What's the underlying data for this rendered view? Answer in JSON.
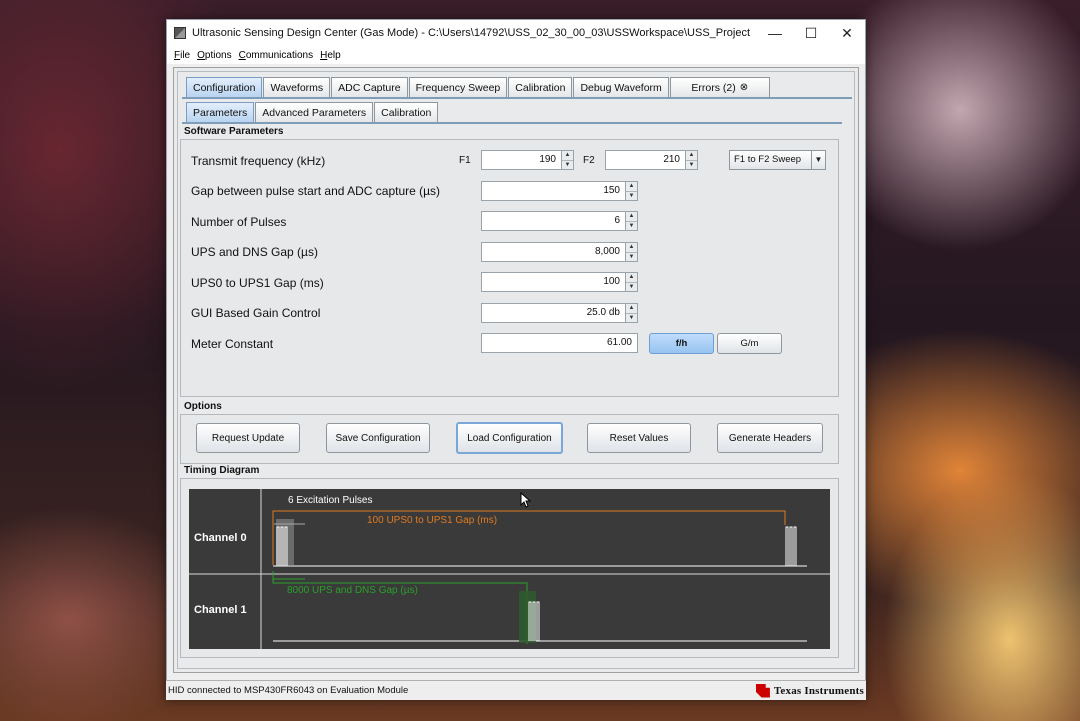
{
  "window": {
    "title": "Ultrasonic Sensing Design Center (Gas Mode) - C:\\Users\\14792\\USS_02_30_00_03\\USSWorkspace\\USS_Project"
  },
  "menu": [
    "File",
    "Options",
    "Communications",
    "Help"
  ],
  "main_tabs": [
    "Configuration",
    "Waveforms",
    "ADC Capture",
    "Frequency Sweep",
    "Calibration",
    "Debug Waveform"
  ],
  "errors_tab": {
    "label": "Errors (2)",
    "close_icon": "⊗"
  },
  "sub_tabs": [
    "Parameters",
    "Advanced Parameters",
    "Calibration"
  ],
  "software_parameters": {
    "heading": "Software Parameters",
    "transmit_frequency": {
      "label": "Transmit frequency (kHz)",
      "f1_label": "F1",
      "f1_value": "190",
      "f2_label": "F2",
      "f2_value": "210",
      "sweep_mode": "F1 to F2 Sweep"
    },
    "gap_pulse_adc": {
      "label": "Gap between pulse start and ADC capture (µs)",
      "value": "150"
    },
    "num_pulses": {
      "label": "Number of Pulses",
      "value": "6"
    },
    "ups_dns_gap": {
      "label": "UPS and DNS Gap (µs)",
      "value": "8,000"
    },
    "ups0_ups1_gap": {
      "label": "UPS0 to UPS1 Gap (ms)",
      "value": "100"
    },
    "gain_control": {
      "label": "GUI Based Gain Control",
      "value": "25.0 db"
    },
    "meter_constant": {
      "label": "Meter Constant",
      "value": "61.00",
      "unit_active": "f/h",
      "unit_alt": "G/m"
    }
  },
  "options": {
    "heading": "Options",
    "buttons": [
      "Request Update",
      "Save Configuration",
      "Load Configuration",
      "Reset Values",
      "Generate Headers"
    ]
  },
  "timing_diagram": {
    "heading": "Timing Diagram",
    "channel0_label": "Channel 0",
    "channel1_label": "Channel 1",
    "pulses_label": "6 Excitation Pulses",
    "ups_gap_label": "100 UPS0 to UPS1 Gap (ms)",
    "dns_gap_label": "8000 UPS and DNS Gap (µs)",
    "colors": {
      "ups": "#e07b20",
      "dns": "#2aa02a",
      "trace": "#ffffff"
    }
  },
  "status": {
    "text": "HID connected to MSP430FR6043 on Evaluation Module",
    "logo_text": "Texas Instruments"
  }
}
